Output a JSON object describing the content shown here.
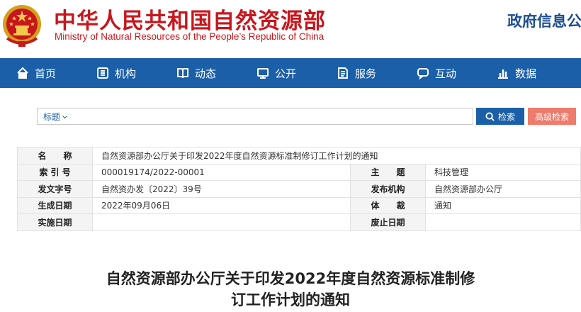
{
  "header": {
    "title": "中华人民共和国自然资源部",
    "subtitle": "Ministry of Natural Resources of the People’s Republic of China",
    "gov_info": "政府信息公"
  },
  "nav": {
    "items": [
      {
        "label": "首页",
        "icon": "home-icon"
      },
      {
        "label": "机构",
        "icon": "org-icon"
      },
      {
        "label": "动态",
        "icon": "book-icon"
      },
      {
        "label": "公开",
        "icon": "monitor-icon"
      },
      {
        "label": "服务",
        "icon": "document-icon"
      },
      {
        "label": "互动",
        "icon": "chat-icon"
      },
      {
        "label": "数据",
        "icon": "bar-chart-icon"
      }
    ]
  },
  "search": {
    "field_select": "标题",
    "value": "",
    "placeholder": "",
    "search_button": "检索",
    "advanced_button": "高级检索"
  },
  "info": {
    "name_label": "名　　称",
    "name_value": "自然资源部办公厅关于印发2022年度自然资源标准制修订工作计划的通知",
    "index_label": "索 引 号",
    "index_value": "000019174/2022-00001",
    "subject_label": "主　　题",
    "subject_value": "科技管理",
    "doc_no_label": "发文字号",
    "doc_no_value": "自然资办发〔2022〕39号",
    "issuer_label": "发布机构",
    "issuer_value": "自然资源部办公厅",
    "date_label": "生成日期",
    "date_value": "2022年09月06日",
    "genre_label": "体　　裁",
    "genre_value": "通知",
    "effective_label": "实施日期",
    "effective_value": "",
    "repeal_label": "废止日期",
    "repeal_value": ""
  },
  "article": {
    "title_line1": "自然资源部办公厅关于印发2022年度自然资源标准制修",
    "title_line2": "订工作计划的通知"
  },
  "colors": {
    "brand_red": "#c8161d",
    "nav_blue": "#1b5fa8",
    "advanced_button": "#ee7b6b"
  }
}
